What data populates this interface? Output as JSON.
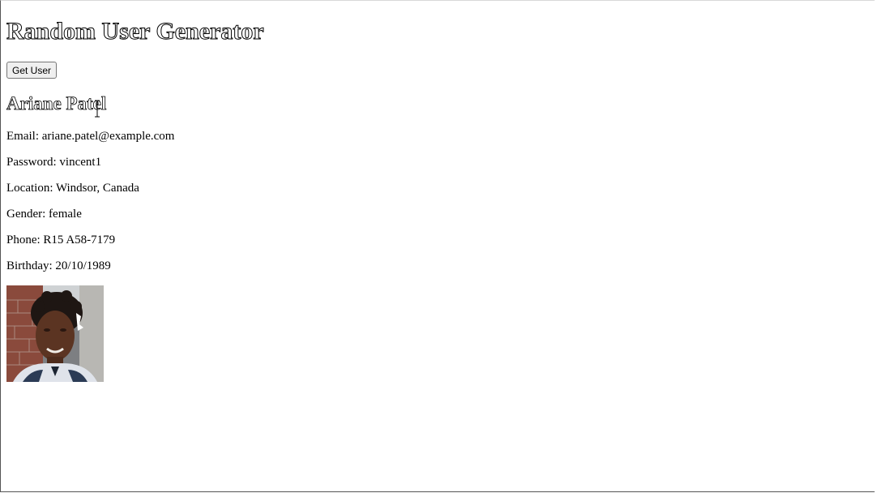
{
  "header": {
    "title": "Random User Generator",
    "get_user_label": "Get User"
  },
  "user": {
    "name": "Ariane Patel",
    "email": "Email: ariane.patel@example.com",
    "password": "Password: vincent1",
    "location": "Location: Windsor, Canada",
    "gender": "Gender: female",
    "phone": "Phone: R15 A58-7179",
    "birthday": "Birthday: 20/10/1989"
  }
}
